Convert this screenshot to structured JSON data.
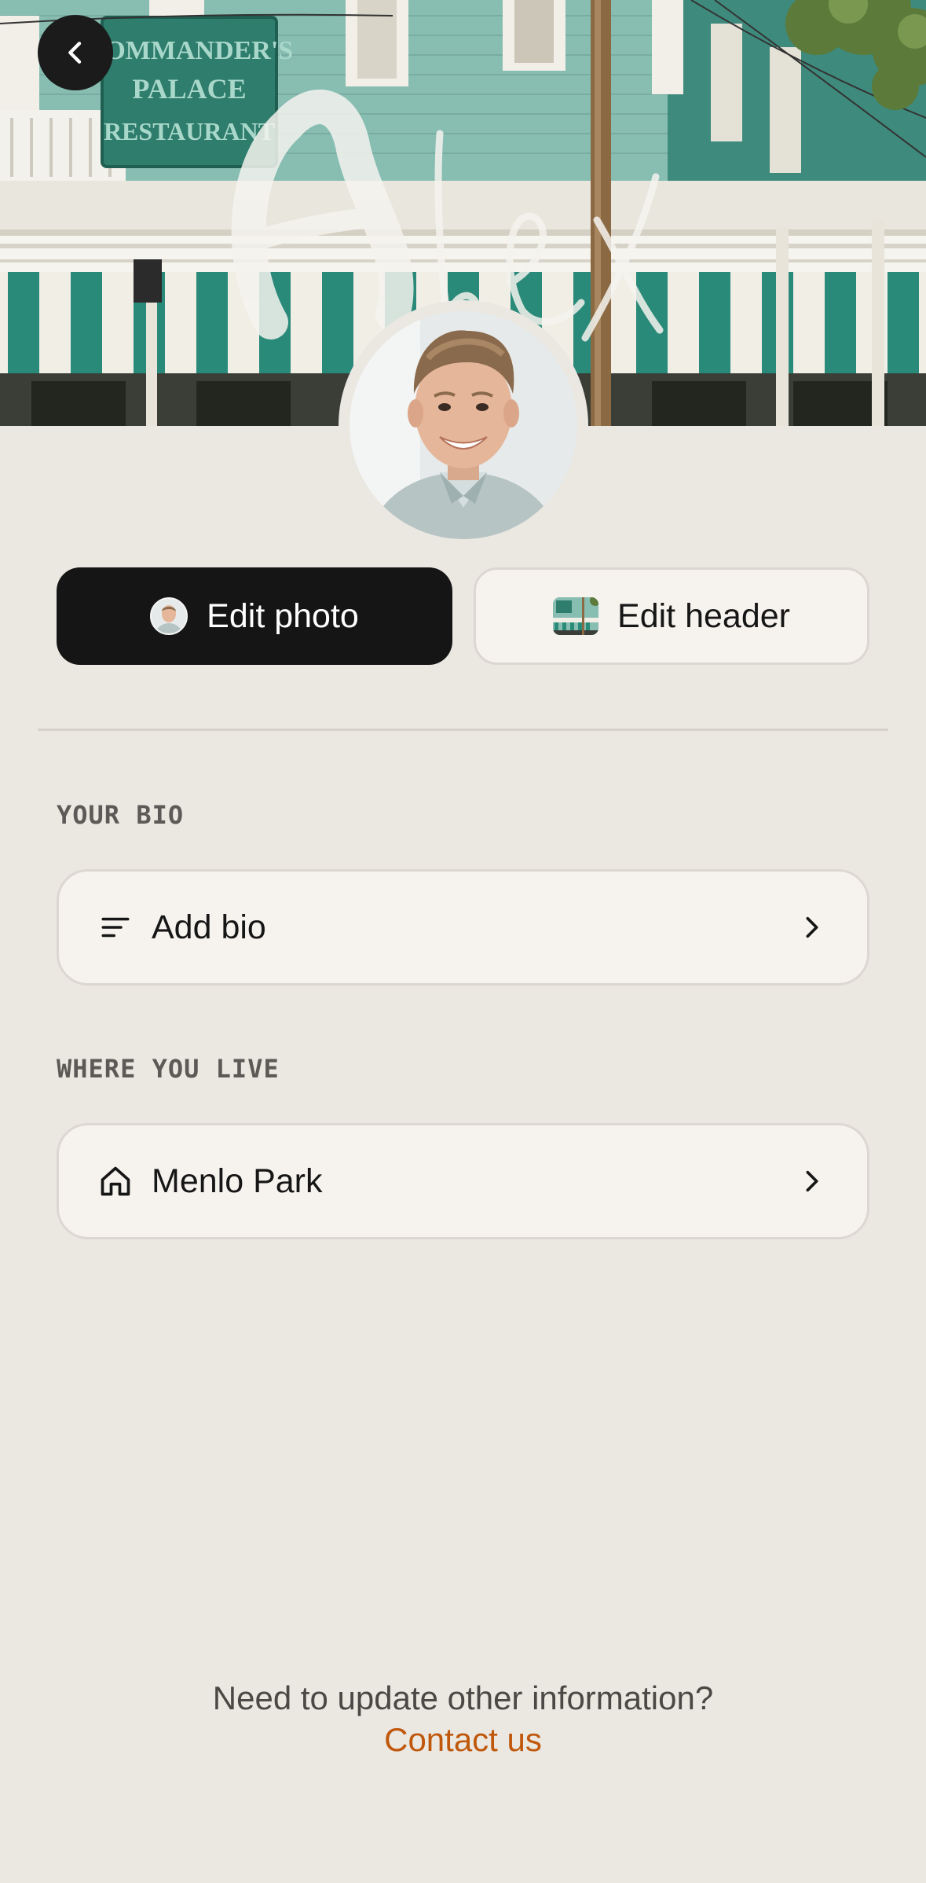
{
  "header": {
    "back_icon": "chevron-left-icon",
    "signature_text": "Alex",
    "sign_text": "COMMANDER'S PALACE RESTAURANT"
  },
  "actions": {
    "edit_photo_label": "Edit photo",
    "edit_header_label": "Edit header"
  },
  "bio": {
    "section_label": "YOUR BIO",
    "row_label": "Add bio",
    "icon": "lines-icon"
  },
  "location": {
    "section_label": "WHERE YOU LIVE",
    "row_label": "Menlo Park",
    "icon": "home-icon"
  },
  "footer": {
    "question": "Need to update other information?",
    "link": "Contact us"
  },
  "colors": {
    "background": "#ebe7e1",
    "primary_button": "#151515",
    "card": "#f6f3ee",
    "link": "#c0580b"
  }
}
